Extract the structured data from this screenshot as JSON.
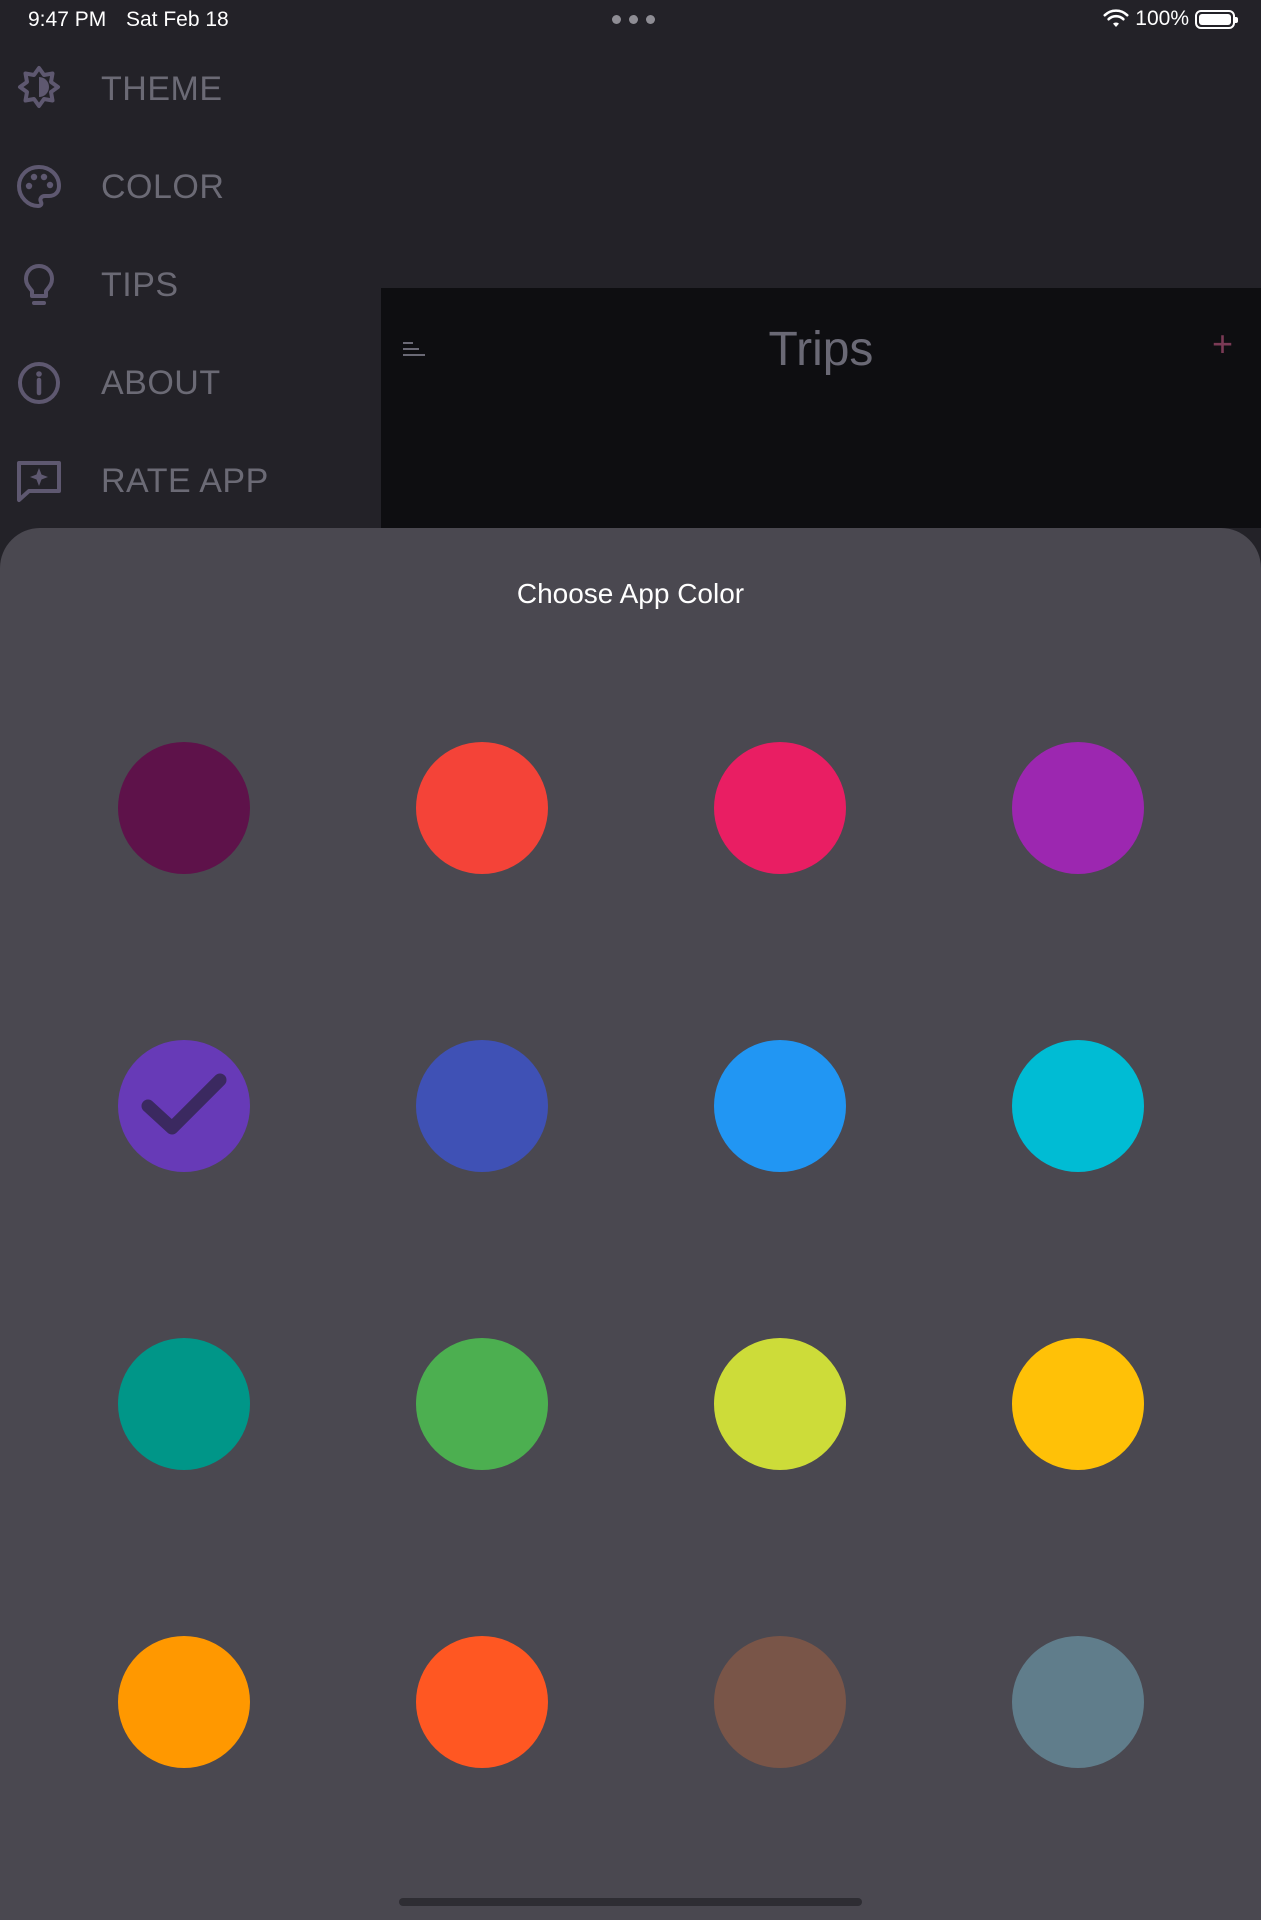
{
  "status_bar": {
    "time": "9:47 PM",
    "date": "Sat Feb 18",
    "battery": "100%",
    "wifi_icon": "wifi-icon"
  },
  "sidebar": {
    "items": [
      {
        "label": "THEME",
        "icon": "brightness-icon"
      },
      {
        "label": "COLOR",
        "icon": "palette-icon"
      },
      {
        "label": "TIPS",
        "icon": "lightbulb-icon"
      },
      {
        "label": "ABOUT",
        "icon": "info-icon"
      },
      {
        "label": "RATE APP",
        "icon": "rate-feedback-icon"
      }
    ],
    "icon_color": "#5e5870"
  },
  "main_panel": {
    "title": "Trips",
    "add_label": "+"
  },
  "color_sheet": {
    "title": "Choose App Color",
    "selected_index": 4,
    "swatches": [
      "#5e124a",
      "#f44338",
      "#e91e63",
      "#9c27b0",
      "#673ab7",
      "#3f51b5",
      "#2196f3",
      "#00bcd4",
      "#009688",
      "#4caf50",
      "#cddc39",
      "#ffc107",
      "#ff9800",
      "#ff5722",
      "#795548",
      "#607d8b"
    ]
  }
}
